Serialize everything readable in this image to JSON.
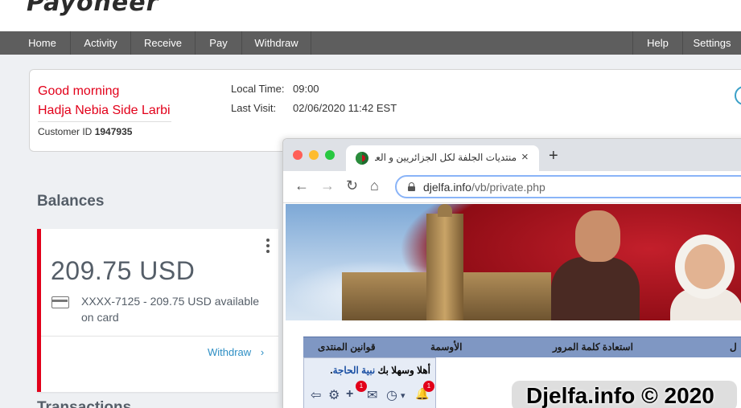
{
  "app": {
    "logo_text": "Payoneer"
  },
  "nav": {
    "left": [
      "Home",
      "Activity",
      "Receive",
      "Pay",
      "Withdraw"
    ],
    "right": [
      "Help",
      "Settings"
    ]
  },
  "greeting": {
    "salutation": "Good morning",
    "name": "Hadja Nebia Side Larbi",
    "customer_id_label": "Customer ID",
    "customer_id": "1947935",
    "local_time_label": "Local Time:",
    "local_time": "09:00",
    "last_visit_label": "Last Visit:",
    "last_visit": "02/06/2020 11:42 EST"
  },
  "balances": {
    "title": "Balances",
    "amount": "209.75 USD",
    "card_text": "XXXX-7125 - 209.75 USD available on card",
    "withdraw_label": "Withdraw",
    "withdraw_chevron": "›"
  },
  "transactions": {
    "title": "Transactions"
  },
  "browser": {
    "tab_title": "منتديات الجلفة لكل الجزائريين و العرب",
    "tab_close": "×",
    "new_tab": "+",
    "url_host": "djelfa.info",
    "url_path": "/vb/private.php",
    "back": "←",
    "forward": "→",
    "reload": "↻",
    "home": "⌂"
  },
  "forum": {
    "nav_links": [
      "قوانين المنتدى",
      "الأوسمة",
      "استعادة كلمة المرور",
      "ل"
    ],
    "welcome_prefix": "أهلا وسهلا بك",
    "welcome_name": "نبية الحاجة",
    "welcome_suffix": ".",
    "badge_friends": "1",
    "badge_notifications": "1",
    "icons": {
      "logout": "⇦",
      "settings": "⚙",
      "add_friend": "+",
      "messages": "✉",
      "clock": "◷",
      "dropdown": "▾",
      "bell": "🔔"
    }
  },
  "watermark": "Djelfa.info © 2020",
  "colors": {
    "brand_red": "#e2001a",
    "nav_bg": "#5e5e5e",
    "link_blue": "#2d8ec4"
  }
}
